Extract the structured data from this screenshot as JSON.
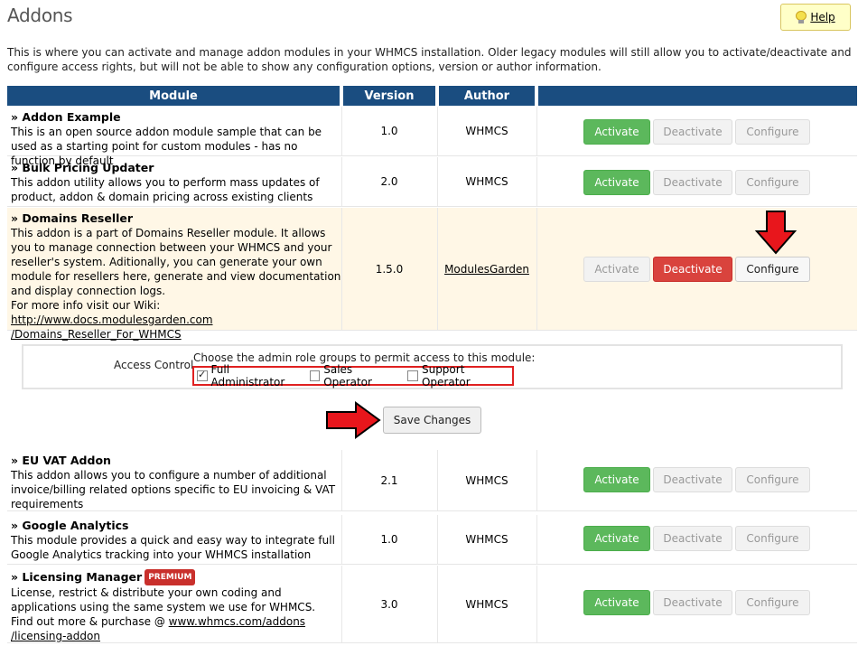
{
  "page": {
    "title": "Addons",
    "help_label": "Help",
    "intro": "This is where you can activate and manage addon modules in your WHMCS installation. Older legacy modules will still allow you to activate/deactivate and configure access rights, but will not be able to show any configuration options, version or author information."
  },
  "table": {
    "headers": [
      "Module",
      "Version",
      "Author",
      ""
    ],
    "buttons": {
      "activate": "Activate",
      "deactivate": "Deactivate",
      "configure": "Configure"
    },
    "rows": [
      {
        "name": "» Addon Example",
        "desc": "This is an open source addon module sample that can be used as a starting point for custom modules - has no function by default",
        "version": "1.0",
        "author": "WHMCS"
      },
      {
        "name": "» Bulk Pricing Updater",
        "desc": "This addon utility allows you to perform mass updates of product, addon & domain pricing across existing clients",
        "version": "2.0",
        "author": "WHMCS"
      },
      {
        "name": "» Domains Reseller",
        "desc": "This addon is a part of Domains Reseller module. It allows you to manage connection between your WHMCS and your reseller's system. Aditionally, you can generate your own module for resellers here, generate and view documentation and display connection logs.",
        "more_prefix": "For more info visit our Wiki: ",
        "link_line1": "http://www.docs.modulesgarden.com",
        "link_line2": "/Domains_Reseller_For_WHMCS",
        "version": "1.5.0",
        "author": "ModulesGarden"
      },
      {
        "name": "» EU VAT Addon",
        "desc": "This addon allows you to configure a number of additional invoice/billing related options specific to EU invoicing & VAT requirements",
        "version": "2.1",
        "author": "WHMCS"
      },
      {
        "name": "» Google Analytics",
        "desc": "This module provides a quick and easy way to integrate full Google Analytics tracking into your WHMCS installation",
        "version": "1.0",
        "author": "WHMCS"
      },
      {
        "name": "» Licensing Manager",
        "badge": "PREMIUM",
        "desc": "License, restrict & distribute your own coding and applications using the same system we use for WHMCS.",
        "more_prefix": "Find out more & purchase @ ",
        "link_line1": "www.whmcs.com/addons",
        "link_line2": "/licensing-addon",
        "version": "3.0",
        "author": "WHMCS"
      }
    ]
  },
  "access": {
    "label": "Access Control",
    "desc": "Choose the admin role groups to permit access to this module:",
    "options": [
      {
        "label": "Full Administrator",
        "checked": true
      },
      {
        "label": "Sales Operator",
        "checked": false
      },
      {
        "label": "Support Operator",
        "checked": false
      }
    ]
  },
  "save_label": "Save Changes",
  "colors": {
    "header": "#1a4d80",
    "activate": "#5cb85c",
    "deactivate": "#d9433d",
    "highlight": "#fff7e6",
    "arrow": "#e8161c"
  }
}
